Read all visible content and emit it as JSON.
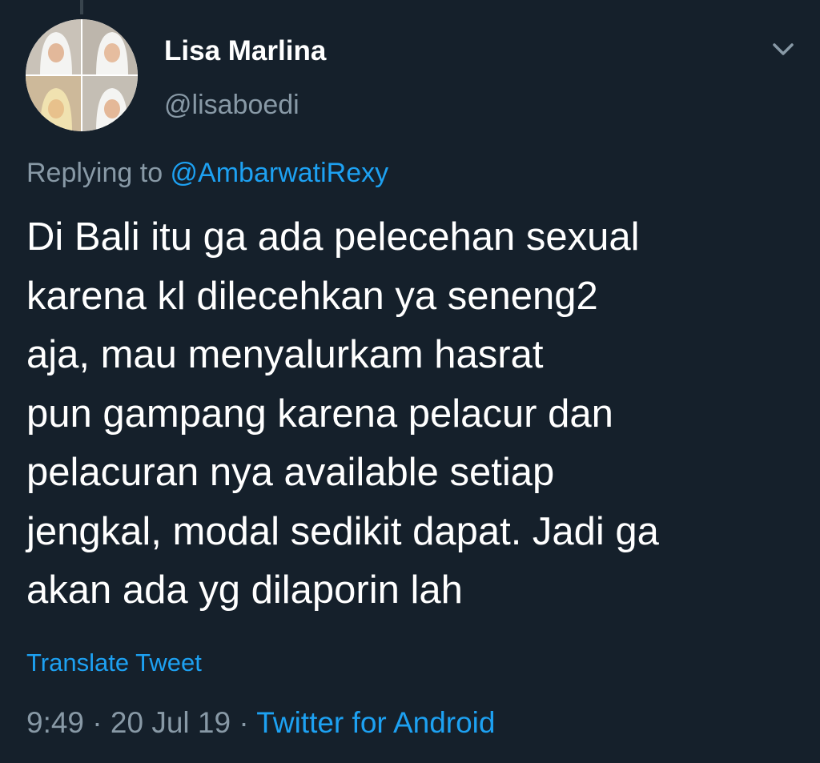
{
  "tweet": {
    "author": {
      "display_name": "Lisa Marlina",
      "handle": "@lisaboedi"
    },
    "reply": {
      "prefix": "Replying to ",
      "mention": "@AmbarwatiRexy"
    },
    "text": "Di Bali itu ga ada pelecehan sexual\nkarena kl dilecehkan ya seneng2\naja,  mau menyalurkam hasrat\npun gampang karena pelacur dan\npelacuran nya available setiap\njengkal, modal sedikit dapat.  Jadi ga\nakan ada yg dilaporin lah",
    "translate_label": "Translate Tweet",
    "time": "9:49",
    "separator": " · ",
    "date": "20 Jul 19",
    "source": "Twitter for Android"
  },
  "icons": {
    "menu": "chevron-down-icon"
  },
  "colors": {
    "background": "#15202b",
    "primary_text": "#ffffff",
    "secondary_text": "#8899a6",
    "accent": "#1da1f2"
  }
}
